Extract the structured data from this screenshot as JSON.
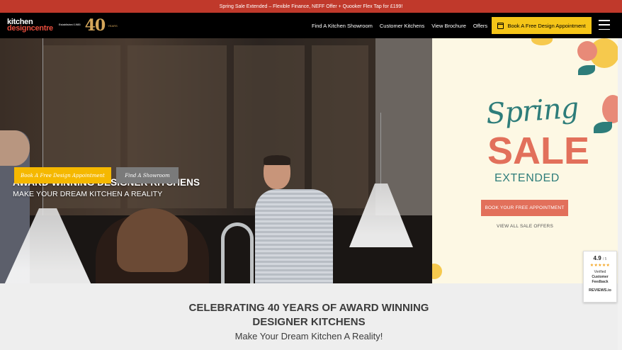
{
  "promo": {
    "text": "Spring Sale Extended – Flexible Finance, NEFF Offer + Quooker Flex Tap for £199!"
  },
  "header": {
    "logo_line1": "kitchen",
    "logo_line2": "designcentre",
    "logo_est": "Established 1985",
    "logo_number": "40",
    "logo_years": "YEARS",
    "nav": [
      "Find A Kitchen Showroom",
      "Customer Kitchens",
      "View Brochure",
      "Offers"
    ],
    "cta_label": "Book A Free Design Appointment"
  },
  "hero": {
    "title": "AWARD WINNING DESIGNER KITCHENS",
    "subtitle": "MAKE YOUR DREAM KITCHEN A REALITY",
    "btn_primary": "Book A Free Design Appointment",
    "btn_secondary": "Find A Showroom"
  },
  "sale": {
    "script_word": "Spring",
    "big_word": "SALE",
    "extended": "EXTENDED",
    "cta_label": "BOOK YOUR FREE APPOINTMENT",
    "link_label": "VIEW ALL SALE OFFERS"
  },
  "section": {
    "title_line1": "CELEBRATING 40 YEARS OF AWARD WINNING",
    "title_line2": "DESIGNER KITCHENS",
    "subtitle": "Make Your Dream Kitchen A Reality!"
  },
  "reviews": {
    "score": "4.9",
    "out_of": "/ 5",
    "stars": "★★★★★",
    "verified_line1": "Verified",
    "verified_line2": "Customer",
    "verified_line3": "Feedback",
    "brand": "REVIEWS.io"
  },
  "colors": {
    "promo_red": "#c0392b",
    "header_black": "#000000",
    "cta_yellow": "#f5c518",
    "sale_teal": "#2e7d7a",
    "sale_coral": "#e2705b",
    "gold": "#d4a65a"
  }
}
